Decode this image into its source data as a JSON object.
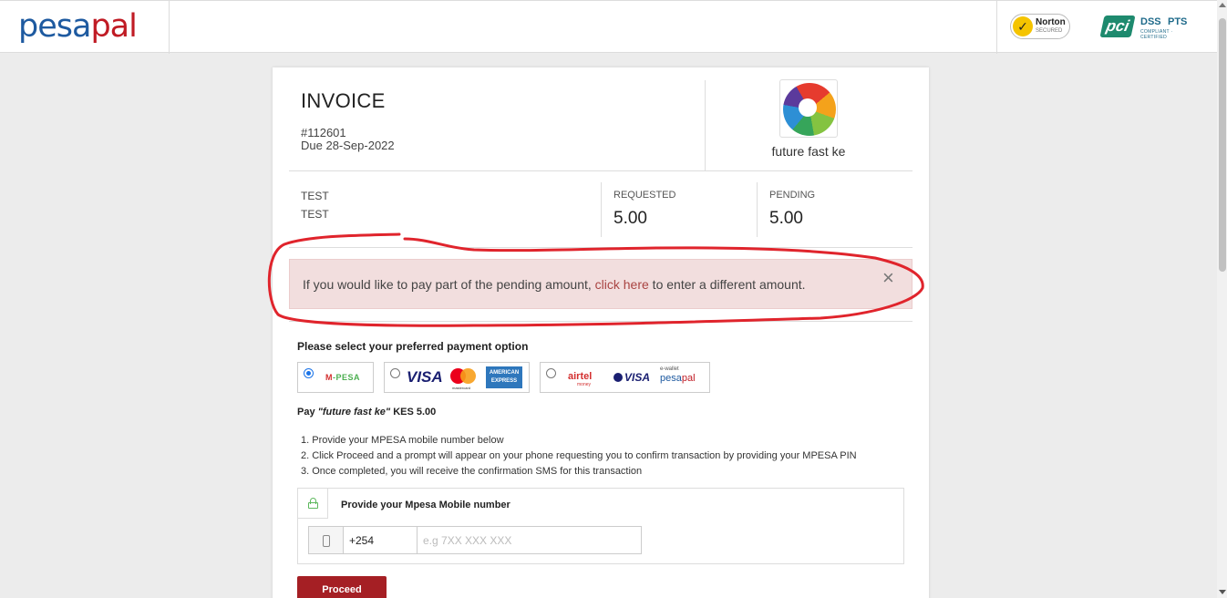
{
  "header": {
    "logo_part1": "pesa",
    "logo_part2": "pal",
    "norton_title": "Norton",
    "norton_sub": "SECURED",
    "pci_mark": "pci",
    "pci_dss": "DSS",
    "pci_pts": "PTS",
    "pci_compliant": "COMPLIANT · CERTIFIED"
  },
  "invoice": {
    "title": "INVOICE",
    "number": "#112601",
    "due": "Due 28-Sep-2022",
    "merchant_name": "future fast ke",
    "description_line1": "TEST",
    "description_line2": "TEST",
    "requested_label": "REQUESTED",
    "requested_value": "5.00",
    "pending_label": "PENDING",
    "pending_value": "5.00"
  },
  "alert": {
    "text_before": "If you would like to pay part of the pending amount, ",
    "link": "click here",
    "text_after": " to enter a different amount.",
    "close": "×"
  },
  "payment": {
    "title": "Please select your preferred payment option",
    "options": [
      {
        "label_m": "M",
        "label_rest": "-PESA",
        "selected": true
      },
      {
        "visa": "VISA",
        "mastercard": "mastercard",
        "amex": "AMERICAN EXPRESS",
        "selected": false
      },
      {
        "airtel": "airtel",
        "airtel_sub": "money",
        "visa": "VISA",
        "ewallet": "e-wallet",
        "ewallet_pesa": "pesa",
        "ewallet_pal": "pal",
        "selected": false
      }
    ],
    "pay_prefix": "Pay ",
    "pay_merchant": "\"future fast ke\"",
    "pay_amount": " KES 5.00",
    "steps": [
      "1. Provide your MPESA mobile number below",
      "2. Click Proceed and a prompt will appear on your phone requesting you to confirm transaction by providing your MPESA PIN",
      "3. Once completed, you will receive the confirmation SMS for this transaction"
    ],
    "mobile_label": "Provide your Mpesa Mobile number",
    "country_code": "+254",
    "phone_placeholder": "e.g 7XX XXX XXX",
    "phone_value": "",
    "proceed_label": "Proceed"
  },
  "colors": {
    "brand_blue": "#1e5aa0",
    "brand_red": "#c01b24",
    "proceed": "#a51f24",
    "alert_bg": "#f2dede",
    "annotation": "#e0242c"
  }
}
